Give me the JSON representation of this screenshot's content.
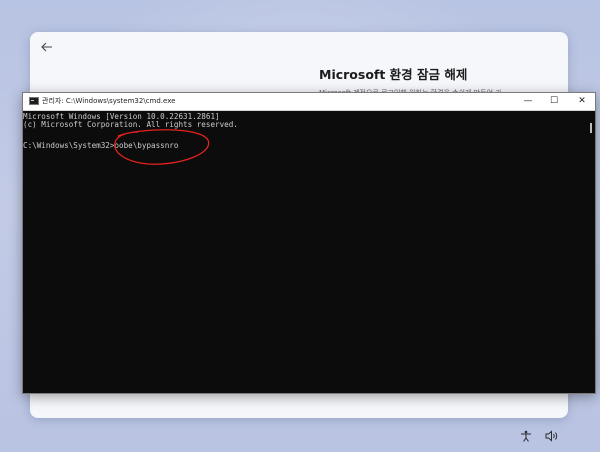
{
  "oobe": {
    "title": "Microsoft 환경 잠금 해제",
    "subtitle": "Microsoft 계정으로 로그인해 원하는 환경을 손쉽게 만들어 가"
  },
  "cmd": {
    "title": "관리자: C:\\Windows\\system32\\cmd.exe",
    "lines": [
      "Microsoft Windows [Version 10.0.22631.2861]",
      "(c) Microsoft Corporation. All rights reserved.",
      "C:\\Windows\\System32>oobe\\bypassnro"
    ],
    "controls": {
      "minimize": "—",
      "maximize": "☐",
      "close": "✕"
    }
  },
  "colors": {
    "annotation": "#e3231e",
    "console_bg": "#0c0c0c",
    "console_text": "#cccccc",
    "accent_button": "#1a63c7"
  },
  "icons": {
    "back": "arrow-left",
    "accessibility": "accessibility",
    "volume": "speaker"
  }
}
